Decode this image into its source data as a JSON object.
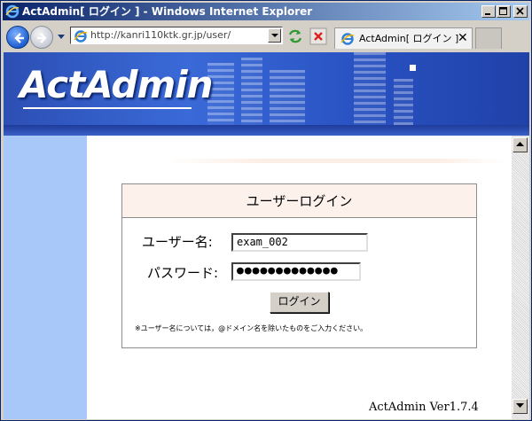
{
  "window": {
    "title": "ActAdmin[ ログイン ] - Windows Internet Explorer",
    "minimize_icon": "minimize-icon",
    "maximize_icon": "maximize-icon",
    "close_icon": "close-icon"
  },
  "toolbar": {
    "address": "http://kanri110ktk.gr.jp/user/",
    "tab_title": "ActAdmin[ ログイン ]",
    "tab_close": "✕"
  },
  "banner": {
    "logo": "ActAdmin"
  },
  "login": {
    "heading": "ユーザーログイン",
    "username_label": "ユーザー名:",
    "username_value": "exam_002",
    "password_label": "パスワード:",
    "password_value": "●●●●●●●●●●●●●",
    "submit_label": "ログイン",
    "note": "※ユーザー名については，@ドメイン名を除いたものをご入力ください。"
  },
  "footer": {
    "version": "ActAdmin Ver1.7.4"
  },
  "colors": {
    "titlebar_start": "#0a246a",
    "banner": "#2c4fb4",
    "side_panel": "#a7c8f8",
    "login_header": "#fdf1ec"
  }
}
